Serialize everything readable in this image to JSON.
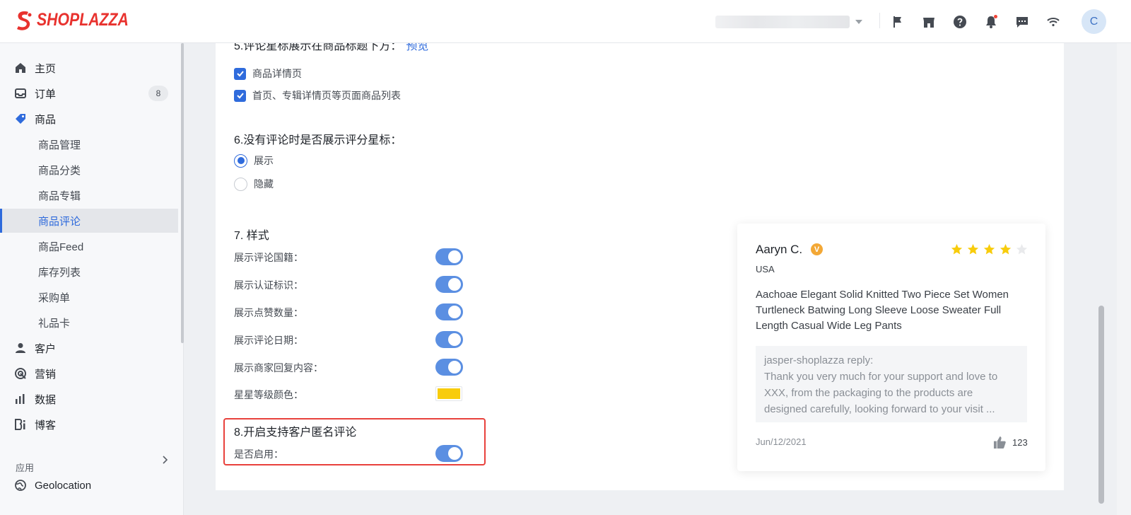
{
  "brand": {
    "name": "SHOPLAZZA",
    "color": "#e8322e"
  },
  "header": {
    "avatar_initial": "C",
    "icons": [
      "flag-icon",
      "store-icon",
      "help-icon",
      "bell-icon",
      "message-icon",
      "wifi-icon"
    ]
  },
  "sidebar": {
    "items": [
      {
        "label": "主页",
        "icon": "home-icon"
      },
      {
        "label": "订单",
        "icon": "inbox-icon",
        "count": "8"
      },
      {
        "label": "商品",
        "icon": "tag-icon"
      },
      {
        "label": "商品管理"
      },
      {
        "label": "商品分类"
      },
      {
        "label": "商品专辑"
      },
      {
        "label": "商品评论",
        "active": true
      },
      {
        "label": "商品Feed"
      },
      {
        "label": "库存列表"
      },
      {
        "label": "采购单"
      },
      {
        "label": "礼品卡"
      },
      {
        "label": "客户",
        "icon": "user-icon"
      },
      {
        "label": "营销",
        "icon": "target-icon"
      },
      {
        "label": "数据",
        "icon": "bar-chart-icon"
      },
      {
        "label": "博客",
        "icon": "blog-icon"
      }
    ],
    "apps_header": "应用",
    "apps": [
      {
        "label": "Geolocation",
        "icon": "globe-icon"
      }
    ]
  },
  "settings": {
    "section5": {
      "title": "5.评论星标展示在商品标题下方：",
      "link": "预览",
      "options": [
        "商品详情页",
        "首页、专辑详情页等页面商品列表"
      ]
    },
    "section6": {
      "title": "6.没有评论时是否展示评分星标：",
      "options": [
        "展示",
        "隐藏"
      ],
      "selected": "展示"
    },
    "section7": {
      "title": "7. 样式",
      "rows": [
        {
          "label": "展示评论国籍：",
          "enabled": true
        },
        {
          "label": "展示认证标识：",
          "enabled": true
        },
        {
          "label": "展示点赞数量：",
          "enabled": true
        },
        {
          "label": "展示评论日期：",
          "enabled": true
        },
        {
          "label": "展示商家回复内容：",
          "enabled": true
        }
      ],
      "star_color_label": "星星等级颜色：",
      "star_color": "#f8cc0c"
    },
    "section8": {
      "title": "8.开启支持客户匿名评论",
      "row_label": "是否启用：",
      "enabled": true,
      "highlight_color": "#e8413c"
    }
  },
  "preview": {
    "name": "Aaryn C.",
    "verified_badge": "V",
    "rating": 4,
    "max_rating": 5,
    "country": "USA",
    "body": "Aachoae Elegant Solid Knitted Two Piece Set Women Turtleneck Batwing Long Sleeve Loose Sweater Full Length Casual Wide Leg Pants",
    "reply_author": "jasper-shoplazza reply:",
    "reply_text": "Thank you very much for your support and love to XXX, from the packaging to the products are designed carefully, looking forward to your visit ...",
    "date": "Jun/12/2021",
    "likes": "123"
  },
  "colors": {
    "accent": "#2f6bdc",
    "toggle_on": "#5b8fe2"
  }
}
